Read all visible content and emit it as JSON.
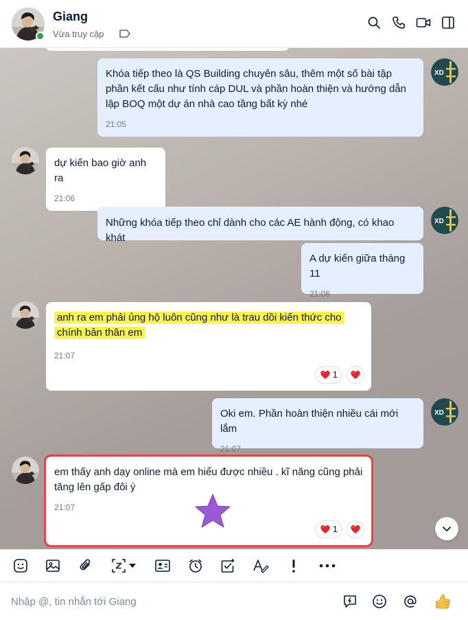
{
  "header": {
    "name": "Giang",
    "status": "Vừa truy cập",
    "icons": [
      "search-icon",
      "phone-icon",
      "video-icon",
      "sidebar-icon"
    ]
  },
  "colors": {
    "accent": "#0068ff",
    "online": "#30a24f",
    "outgoing_bubble": "#e5efff",
    "highlight": "#fbf24c",
    "outline": "#e64248",
    "star": "#9b59d6"
  },
  "messages": [
    {
      "direction": "out",
      "text": "Khóa tiếp theo là QS Building chuyên sâu, thêm một số bài tập phần kết cấu như tính cáp DUL và phần hoàn thiện và hướng dẫn lập BOQ một dự án nhà cao tầng bất kỳ nhé",
      "time": "21:05"
    },
    {
      "direction": "in",
      "text": "dự kiến bao giờ anh ra",
      "time": "21:06"
    },
    {
      "direction": "out",
      "text": "Những khóa tiếp theo chỉ dành cho các AE hành động, có khao khát"
    },
    {
      "direction": "out",
      "text": "A dự kiến giữa tháng 11",
      "time": "21:06"
    },
    {
      "direction": "in",
      "text": "anh ra em phải ủng hộ luôn cũng như là trau dồi kiến thức cho chính bản thân em",
      "time": "21:07",
      "reaction_count": "1"
    },
    {
      "direction": "out",
      "text": "Oki em. Phần hoàn thiện nhiều cái mới lắm",
      "time": "21:07"
    },
    {
      "direction": "in",
      "text": "em thấy anh dạy online mà em hiểu được nhiều . kĩ năng cũng phải tăng lên gấp đôi ý",
      "time": "21:07",
      "reaction_count": "1"
    }
  ],
  "toolbar": {
    "icons": [
      "sticker-icon",
      "image-icon",
      "attachment-icon",
      "screenshot-icon",
      "dropdown-icon",
      "contact-card-icon",
      "reminder-icon",
      "task-icon",
      "text-format-icon",
      "urgent-icon",
      "more-icon"
    ]
  },
  "composer": {
    "placeholder": "Nhập @, tin nhắn tới Giang",
    "icons": [
      "quick-message-icon",
      "emoji-icon",
      "mention-icon",
      "thumbs-up-icon"
    ]
  }
}
